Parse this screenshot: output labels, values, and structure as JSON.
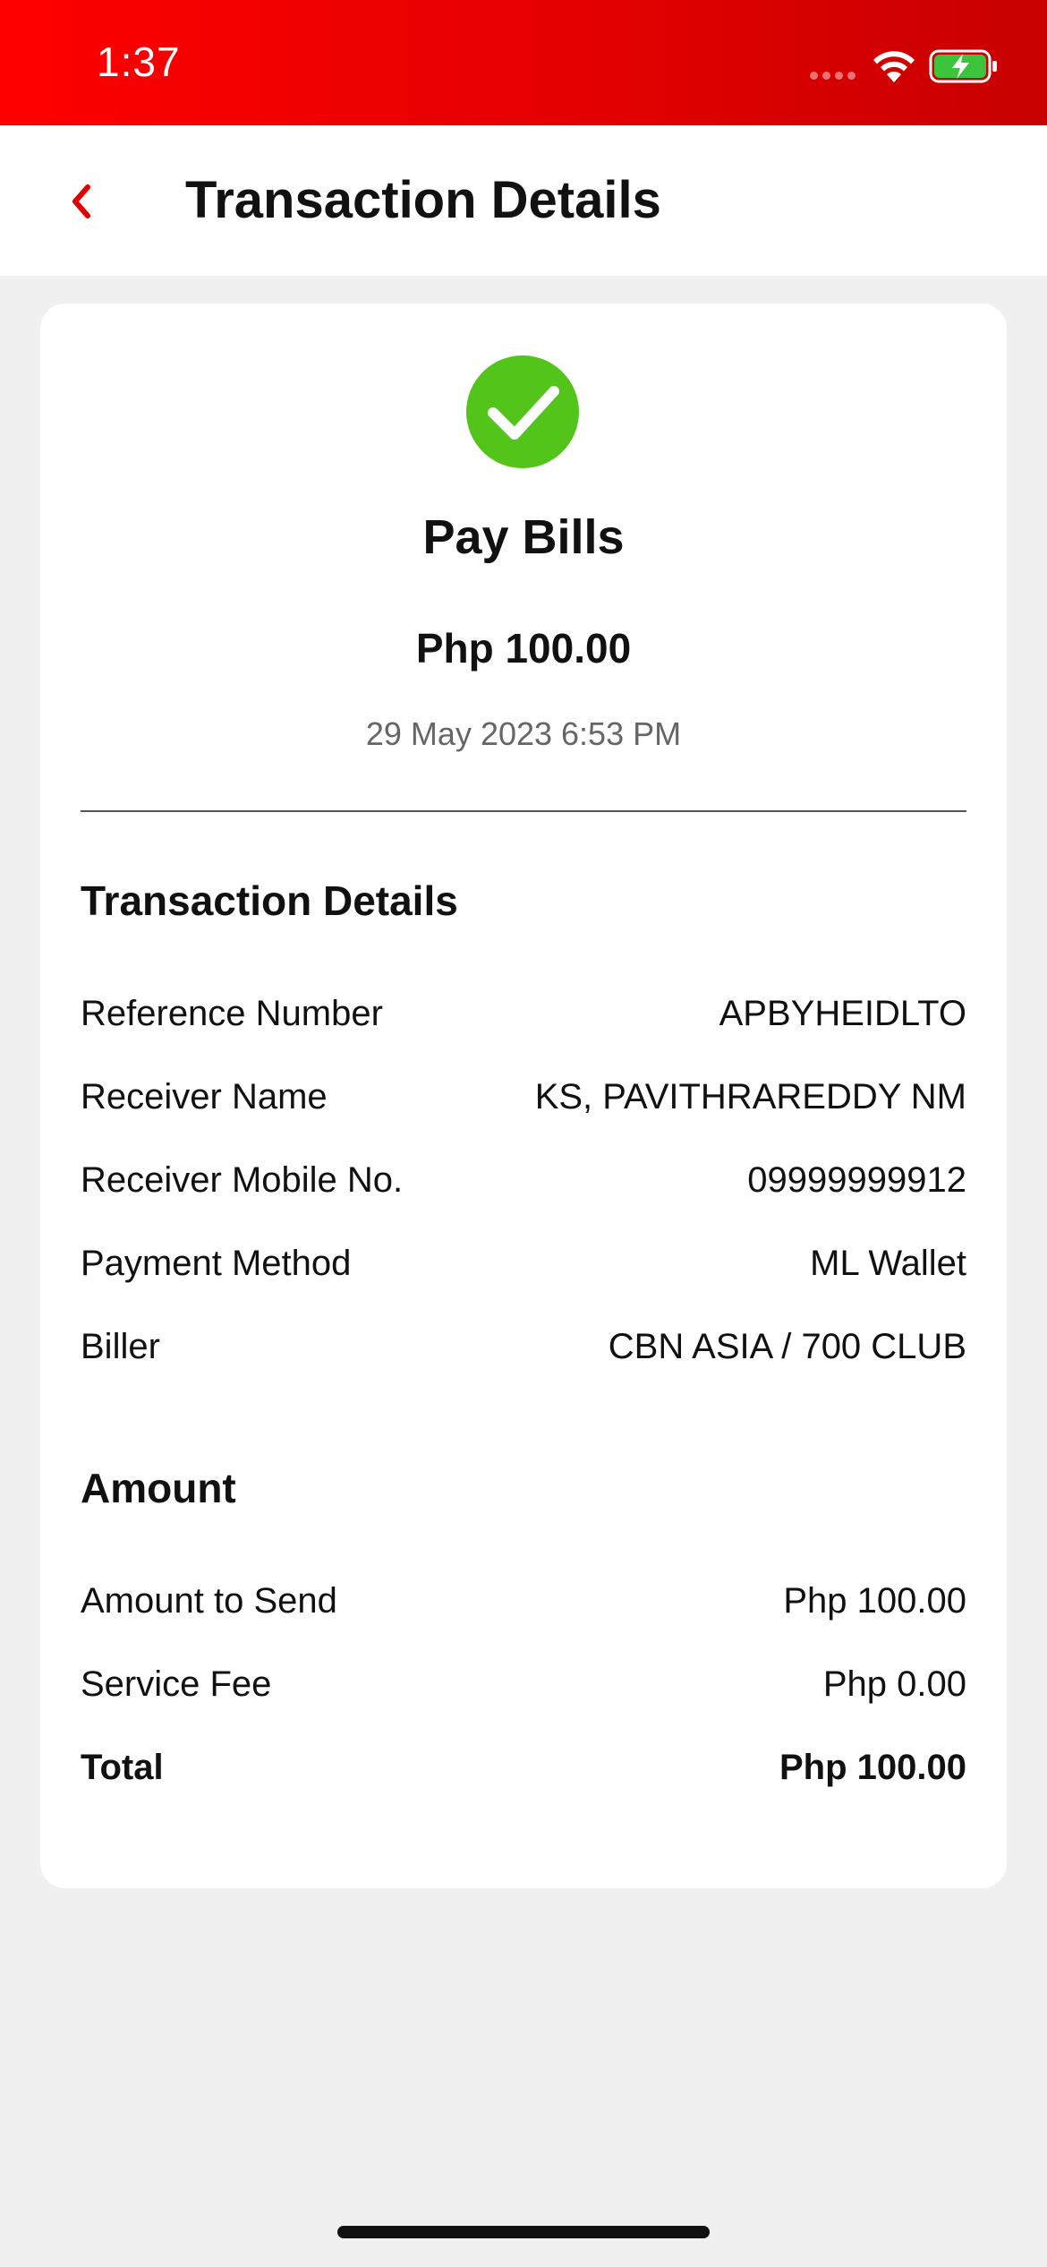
{
  "status_bar": {
    "time": "1:37",
    "colors": {
      "background": "#e60000",
      "battery_fill": "#3cc43c"
    }
  },
  "nav": {
    "back_icon": "chevron-left-icon",
    "title": "Transaction Details",
    "accent_color": "#e00000"
  },
  "summary": {
    "status_icon": "check-circle-icon",
    "status_color": "#52c41a",
    "type": "Pay Bills",
    "amount": "Php 100.00",
    "datetime": "29 May 2023 6:53 PM"
  },
  "transaction_details": {
    "heading": "Transaction Details",
    "rows": [
      {
        "label": "Reference Number",
        "value": "APBYHEIDLTO"
      },
      {
        "label": "Receiver Name",
        "value": "KS, PAVITHRAREDDY NM"
      },
      {
        "label": "Receiver Mobile No.",
        "value": "09999999912"
      },
      {
        "label": "Payment Method",
        "value": "ML Wallet"
      },
      {
        "label": "Biller",
        "value": "CBN ASIA / 700 CLUB"
      }
    ]
  },
  "amount_section": {
    "heading": "Amount",
    "rows": [
      {
        "label": "Amount to Send",
        "value": "Php 100.00"
      },
      {
        "label": "Service Fee",
        "value": "Php 0.00"
      },
      {
        "label": "Total",
        "value": "Php 100.00"
      }
    ]
  }
}
